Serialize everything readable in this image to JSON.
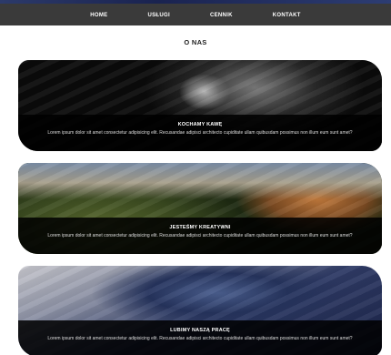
{
  "nav": {
    "items": [
      {
        "label": "HOME"
      },
      {
        "label": "USŁUGI"
      },
      {
        "label": "CENNIK"
      },
      {
        "label": "KONTAKT"
      }
    ]
  },
  "section": {
    "title": "O NAS"
  },
  "cards": [
    {
      "title": "KOCHAMY KAWĘ",
      "text": "Lorem ipsum dolor sit amet consectetur adipisicing elit. Recusandae adipisci architecto cupiditate ullam quibusdam possimus non illum eum sunt amet?"
    },
    {
      "title": "JESTEŚMY KREATYWNI",
      "text": "Lorem ipsum dolor sit amet consectetur adipisicing elit. Recusandae adipisci architecto cupiditate ullam quibusdam possimus non illum eum sunt amet?"
    },
    {
      "title": "LUBIMY NASZĄ PRACĘ",
      "text": "Lorem ipsum dolor sit amet consectetur adipisicing elit. Recusandae adipisci architecto cupiditate ullam quibusdam possimus non illum eum sunt amet?"
    }
  ]
}
